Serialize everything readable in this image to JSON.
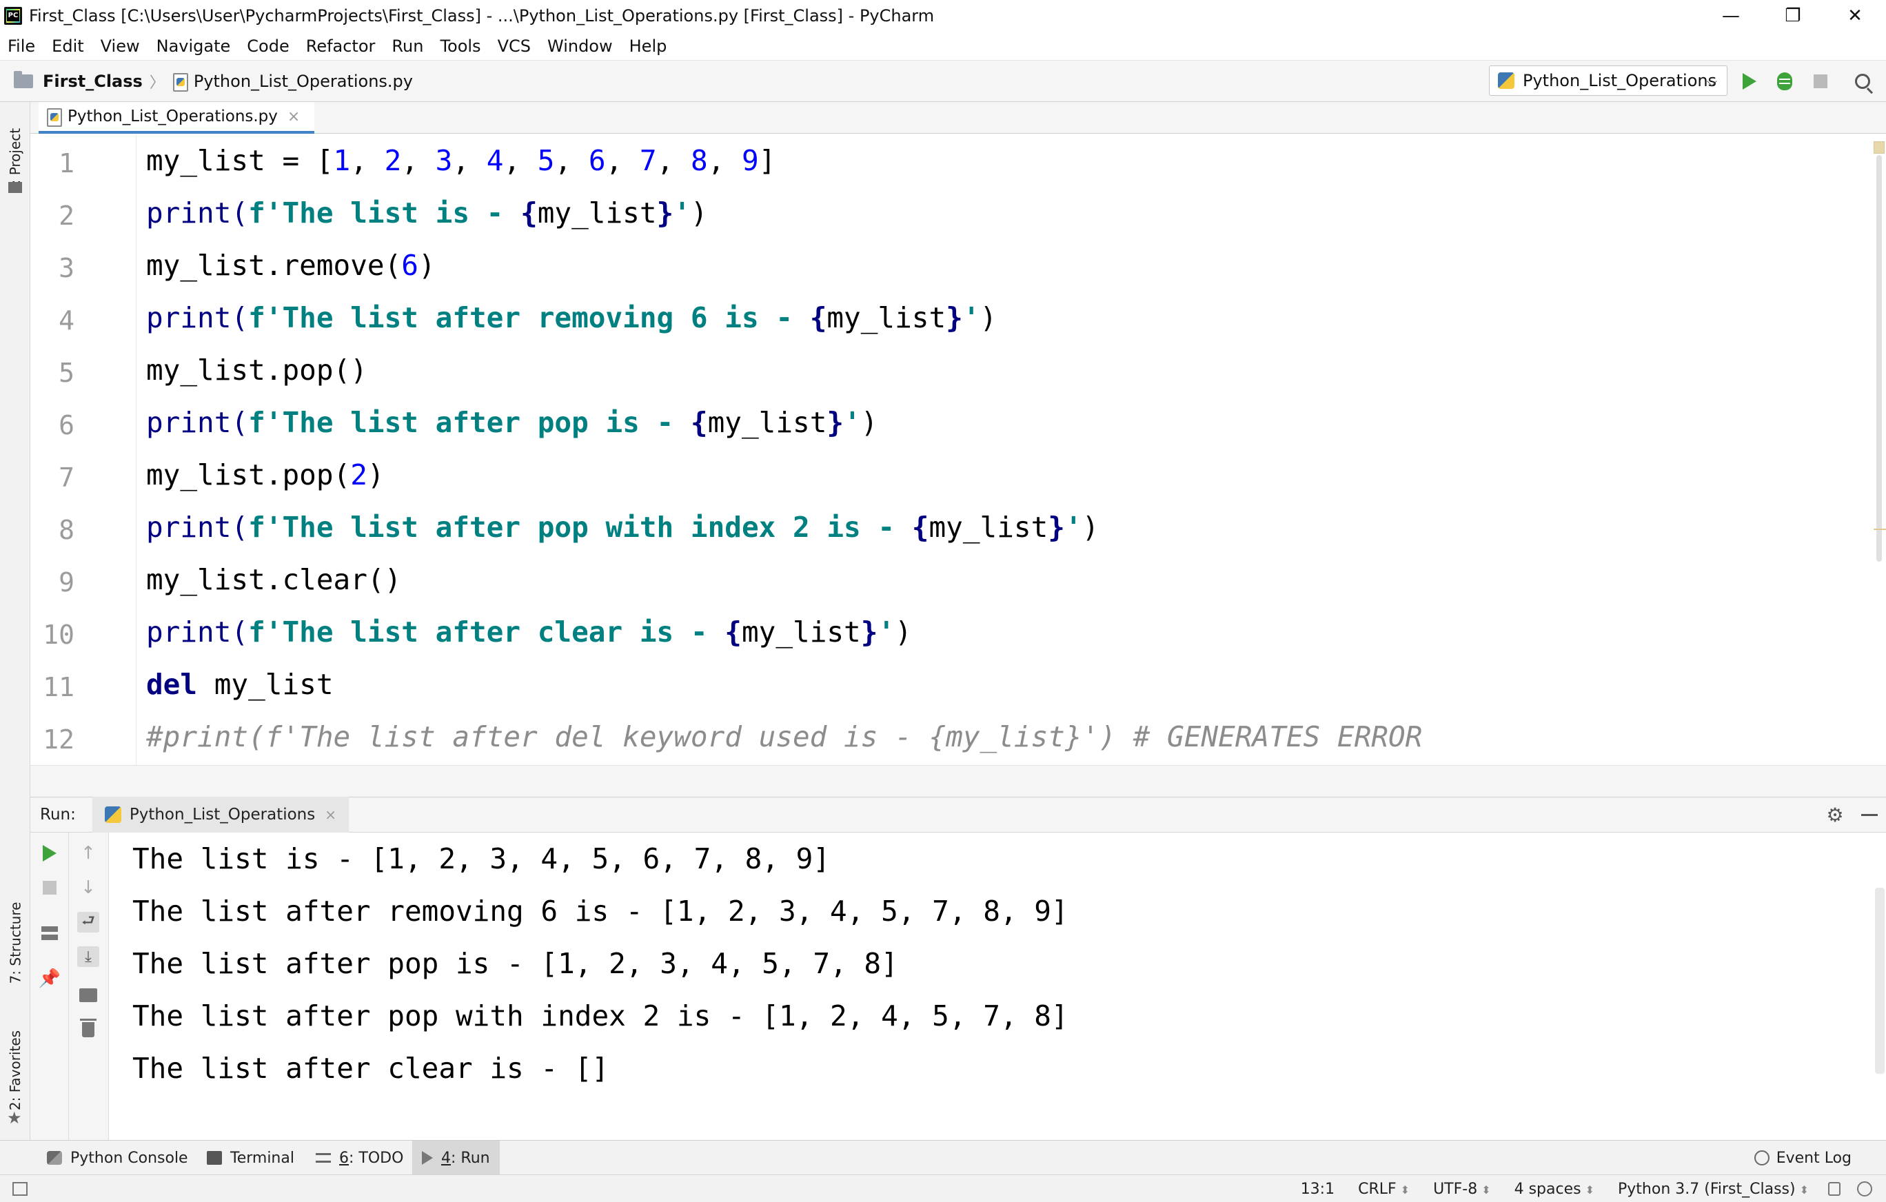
{
  "window": {
    "title": "First_Class [C:\\Users\\User\\PycharmProjects\\First_Class] - ...\\Python_List_Operations.py [First_Class] - PyCharm",
    "minimize": "—",
    "restore": "❐",
    "close": "✕"
  },
  "menu": [
    "File",
    "Edit",
    "View",
    "Navigate",
    "Code",
    "Refactor",
    "Run",
    "Tools",
    "VCS",
    "Window",
    "Help"
  ],
  "navbar": {
    "project": "First_Class",
    "separator": "〉",
    "file": "Python_List_Operations.py",
    "run_config": "Python_List_Operations",
    "chevron": "⌵"
  },
  "left_strip": {
    "project_tab": "1: Project",
    "structure_tab": "7: Structure",
    "favorites_tab": "2: Favorites"
  },
  "editor_tab": {
    "label": "Python_List_Operations.py",
    "close": "×"
  },
  "line_numbers": [
    "1",
    "2",
    "3",
    "4",
    "5",
    "6",
    "7",
    "8",
    "9",
    "10",
    "11",
    "12"
  ],
  "code": {
    "l1": {
      "a": "my_list = [",
      "n1": "1",
      "c1": ", ",
      "n2": "2",
      "c2": ", ",
      "n3": "3",
      "c3": ", ",
      "n4": "4",
      "c4": ", ",
      "n5": "5",
      "c5": ", ",
      "n6": "6",
      "c6": ", ",
      "n7": "7",
      "c7": ", ",
      "n8": "8",
      "c8": ", ",
      "n9": "9",
      "b": "]"
    },
    "l2": {
      "p": "print(",
      "s1": "f'The list is - ",
      "o": "{",
      "v": "my_list",
      "c": "}",
      "s2": "'",
      "e": ")"
    },
    "l3": {
      "a": "my_list.remove(",
      "n": "6",
      "b": ")"
    },
    "l4": {
      "p": "print(",
      "s1": "f'The list after removing 6 is - ",
      "o": "{",
      "v": "my_list",
      "c": "}",
      "s2": "'",
      "e": ")"
    },
    "l5": {
      "a": "my_list.pop()"
    },
    "l6": {
      "p": "print(",
      "s1": "f'The list after pop is - ",
      "o": "{",
      "v": "my_list",
      "c": "}",
      "s2": "'",
      "e": ")"
    },
    "l7": {
      "a": "my_list.pop(",
      "n": "2",
      "b": ")"
    },
    "l8": {
      "p": "print(",
      "s1": "f'The list after pop with index 2 is - ",
      "o": "{",
      "v": "my_list",
      "c": "}",
      "s2": "'",
      "e": ")"
    },
    "l9": {
      "a": "my_list.clear()"
    },
    "l10": {
      "p": "print(",
      "s1": "f'The list after clear is - ",
      "o": "{",
      "v": "my_list",
      "c": "}",
      "s2": "'",
      "e": ")"
    },
    "l11": {
      "k": "del",
      "a": " my_list"
    },
    "l12": {
      "c": "#print(f'The list after del keyword used is - {my_list}') # GENERATES ERROR"
    }
  },
  "run_panel": {
    "label": "Run:",
    "tab": "Python_List_Operations",
    "tab_close": "×",
    "settings": "⚙",
    "output": [
      "The list is - [1, 2, 3, 4, 5, 6, 7, 8, 9]",
      "The list after removing 6 is - [1, 2, 3, 4, 5, 7, 8, 9]",
      "The list after pop is - [1, 2, 3, 4, 5, 7, 8]",
      "The list after pop with index 2 is - [1, 2, 4, 5, 7, 8]",
      "The list after clear is - []"
    ],
    "up_arrow": "↑",
    "down_arrow": "↓",
    "wrap": "⮐",
    "scroll_end": "⤓",
    "pin": "📌"
  },
  "bottom_tabs": {
    "python_console": "Python Console",
    "terminal": "Terminal",
    "todo_num": "6",
    "todo": ": TODO",
    "run_num": "4",
    "run": ": Run",
    "event_log": "Event Log"
  },
  "status": {
    "position": "13:1",
    "line_sep": "CRLF",
    "encoding": "UTF-8",
    "indent": "4 spaces",
    "interpreter": "Python 3.7 (First_Class)",
    "updown": "⬍"
  }
}
